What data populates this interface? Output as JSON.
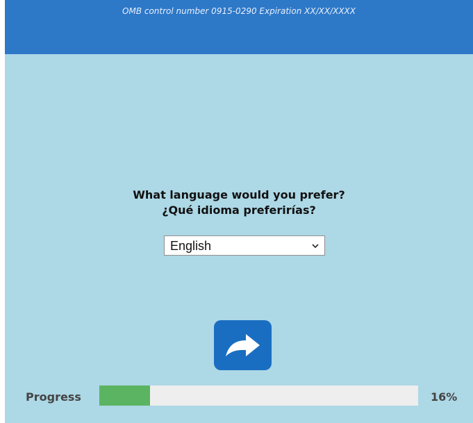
{
  "header": {
    "omb_text": "OMB control number 0915-0290 Expiration XX/XX/XXXX"
  },
  "question": {
    "english": "What language would you prefer?",
    "spanish": "¿Qué idioma preferirías?"
  },
  "language_select": {
    "selected": "English"
  },
  "next_button": {
    "icon": "forward-arrow-icon"
  },
  "progress": {
    "label": "Progress",
    "percent_text": "16%",
    "fraction": 0.16
  },
  "colors": {
    "header": "#2e78c8",
    "background": "#add8e6",
    "button": "#1a6ec2",
    "progress_fill": "#5bb462",
    "progress_track": "#eeeeee"
  }
}
